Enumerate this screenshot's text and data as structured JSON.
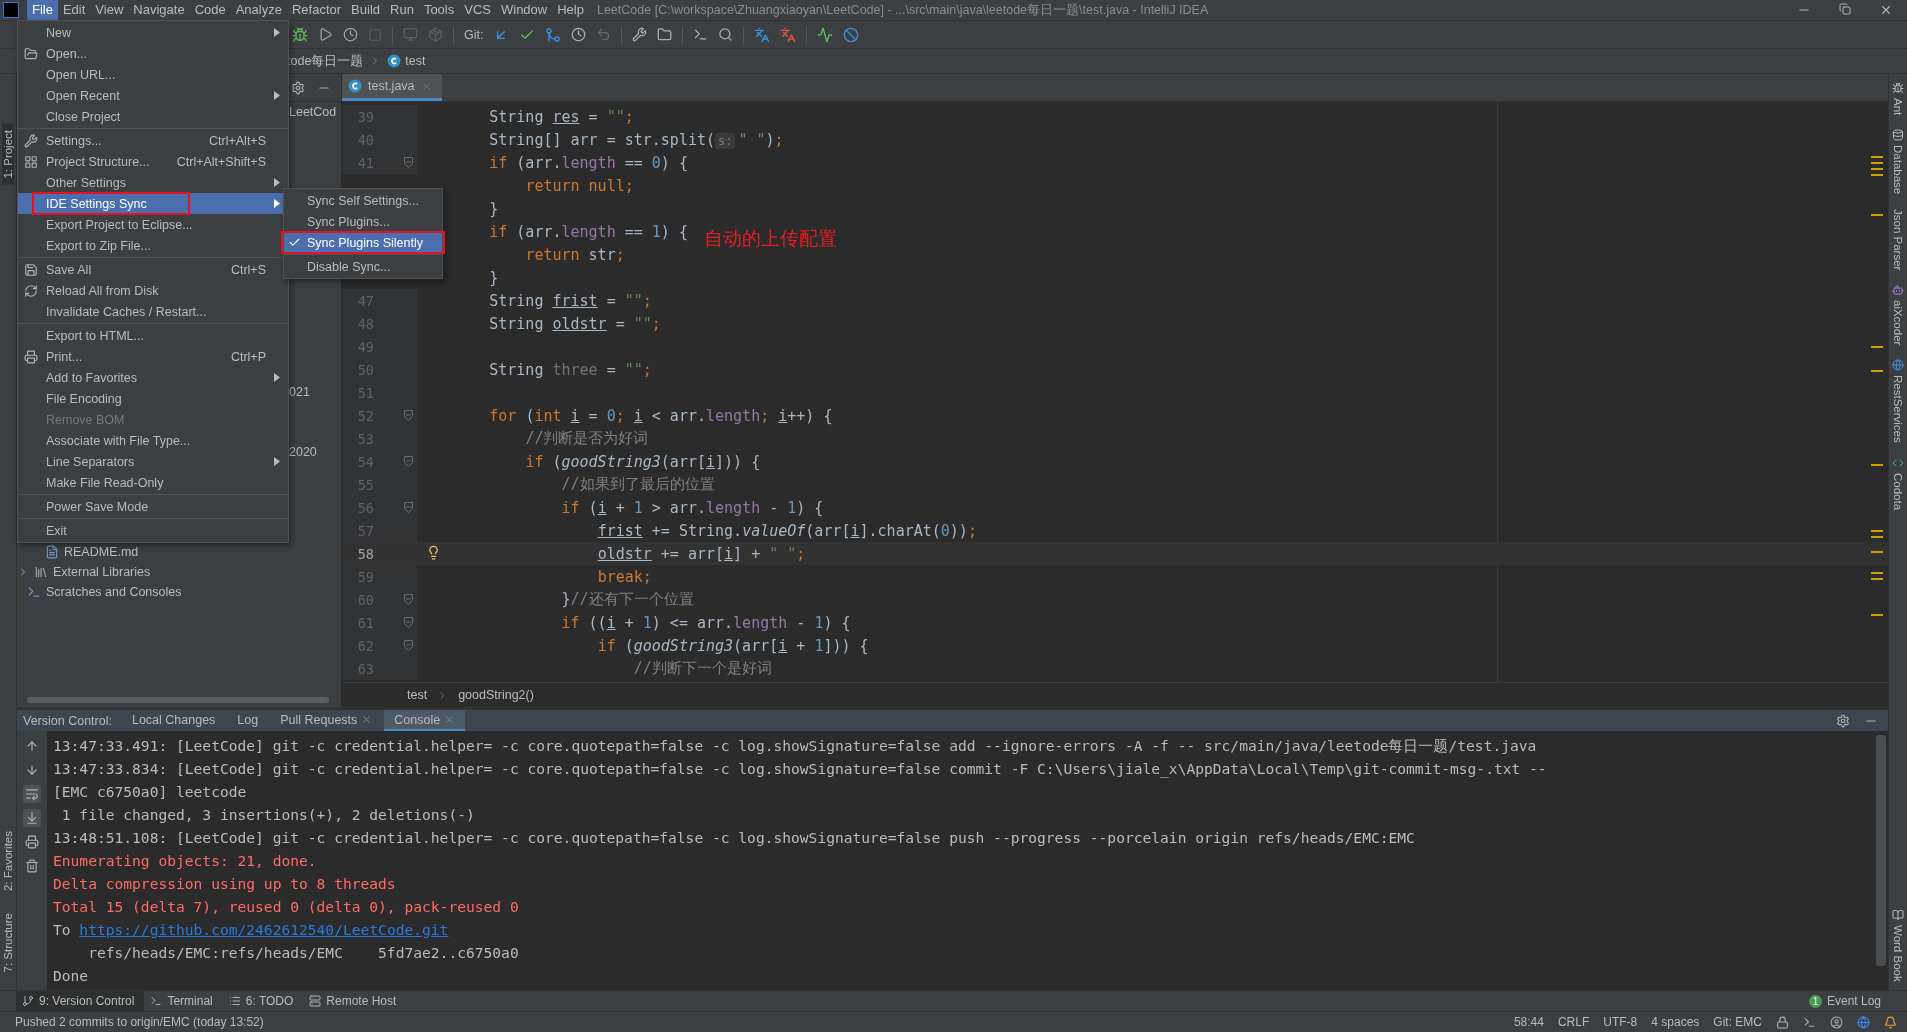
{
  "menubar": {
    "items": [
      {
        "label": "File",
        "selected": true
      },
      {
        "label": "Edit",
        "selected": false
      },
      {
        "label": "View",
        "selected": false
      },
      {
        "label": "Navigate",
        "selected": false
      },
      {
        "label": "Code",
        "selected": false
      },
      {
        "label": "Analyze",
        "selected": false
      },
      {
        "label": "Refactor",
        "selected": false
      },
      {
        "label": "Build",
        "selected": false
      },
      {
        "label": "Run",
        "selected": false
      },
      {
        "label": "Tools",
        "selected": false
      },
      {
        "label": "VCS",
        "selected": false
      },
      {
        "label": "Window",
        "selected": false
      },
      {
        "label": "Help",
        "selected": false
      }
    ],
    "title": "LeetCode [C:\\workspace\\Zhuangxiaoyan\\LeetCode] - ...\\src\\main\\java\\leetode每日一题\\test.java - IntelliJ IDEA"
  },
  "toolbar": {
    "git_label": "Git:"
  },
  "navbar": {
    "crumbs": [
      {
        "label": "tode每日一题"
      },
      {
        "label": "test"
      }
    ]
  },
  "left_strip": {
    "labels": [
      {
        "label": "1: Project",
        "selected": true
      },
      {
        "label": "2: Favorites",
        "selected": false
      },
      {
        "label": "7: Structure",
        "selected": false
      }
    ]
  },
  "project_panel": {
    "rows": [
      {
        "label": "LeetCod",
        "kind": "fragment"
      },
      {
        "label": "021",
        "kind": "fragment"
      },
      {
        "label": "2020",
        "kind": "fragment"
      },
      {
        "label": "README.md",
        "kind": "file"
      },
      {
        "label": "External Libraries",
        "kind": "library"
      },
      {
        "label": "Scratches and Consoles",
        "kind": "scratch"
      }
    ]
  },
  "editor": {
    "tab": {
      "label": "test.java",
      "selected": true
    },
    "lines": [
      {
        "number": "39",
        "current": false,
        "fold": false,
        "segs": [
          {
            "text": "        String ",
            "kind": "plain"
          },
          {
            "text": "res",
            "kind": "var"
          },
          {
            "text": " = ",
            "kind": "plain"
          },
          {
            "text": "\"\"",
            "kind": "string"
          },
          {
            "text": ";",
            "kind": "keyword"
          }
        ]
      },
      {
        "number": "40",
        "current": false,
        "fold": false,
        "segs": [
          {
            "text": "        String[] arr = str.split(",
            "kind": "plain"
          },
          {
            "text": "s:",
            "kind": "hint"
          },
          {
            "text": "\" \"",
            "kind": "string"
          },
          {
            "text": ")",
            "kind": "plain"
          },
          {
            "text": ";",
            "kind": "keyword"
          }
        ]
      },
      {
        "number": "41",
        "current": false,
        "fold": true,
        "segs": [
          {
            "text": "        if ",
            "kind": "keyword"
          },
          {
            "text": "(arr.",
            "kind": "plain"
          },
          {
            "text": "length",
            "kind": "field"
          },
          {
            "text": " == ",
            "kind": "plain"
          },
          {
            "text": "0",
            "kind": "number"
          },
          {
            "text": ") {",
            "kind": "plain"
          }
        ]
      },
      {
        "fold": false,
        "segs": [
          {
            "text": "            return null;",
            "kind": "keyword"
          }
        ]
      },
      {
        "fold": false,
        "segs": [
          {
            "text": "        }",
            "kind": "plain"
          }
        ]
      },
      {
        "fold": false,
        "segs": [
          {
            "text": "        if ",
            "kind": "keyword"
          },
          {
            "text": "(arr.",
            "kind": "plain"
          },
          {
            "text": "length",
            "kind": "field"
          },
          {
            "text": " == ",
            "kind": "plain"
          },
          {
            "text": "1",
            "kind": "number"
          },
          {
            "text": ") {",
            "kind": "plain"
          }
        ]
      },
      {
        "fold": false,
        "segs": [
          {
            "text": "            return ",
            "kind": "keyword"
          },
          {
            "text": "str",
            "kind": "plain"
          },
          {
            "text": ";",
            "kind": "keyword"
          }
        ]
      },
      {
        "fold": false,
        "segs": [
          {
            "text": "        }",
            "kind": "plain"
          }
        ]
      },
      {
        "number": "47",
        "current": false,
        "fold": false,
        "segs": [
          {
            "text": "        String ",
            "kind": "plain"
          },
          {
            "text": "frist",
            "kind": "var"
          },
          {
            "text": " = ",
            "kind": "plain"
          },
          {
            "text": "\"\"",
            "kind": "string"
          },
          {
            "text": ";",
            "kind": "keyword"
          }
        ]
      },
      {
        "number": "48",
        "current": false,
        "fold": false,
        "segs": [
          {
            "text": "        String ",
            "kind": "plain"
          },
          {
            "text": "oldstr",
            "kind": "var"
          },
          {
            "text": " = ",
            "kind": "plain"
          },
          {
            "text": "\"\"",
            "kind": "string"
          },
          {
            "text": ";",
            "kind": "keyword"
          }
        ]
      },
      {
        "number": "49",
        "current": false,
        "fold": false
      },
      {
        "number": "50",
        "current": false,
        "fold": false,
        "segs": [
          {
            "text": "        String ",
            "kind": "plain"
          },
          {
            "text": "three",
            "kind": "unused"
          },
          {
            "text": " = ",
            "kind": "plain"
          },
          {
            "text": "\"\"",
            "kind": "string"
          },
          {
            "text": ";",
            "kind": "keyword"
          }
        ]
      },
      {
        "number": "51",
        "current": false,
        "fold": false
      },
      {
        "number": "52",
        "current": false,
        "fold": true,
        "segs": [
          {
            "text": "        for ",
            "kind": "keyword"
          },
          {
            "text": "(",
            "kind": "plain"
          },
          {
            "text": "int ",
            "kind": "keyword"
          },
          {
            "text": "i",
            "kind": "var"
          },
          {
            "text": " = ",
            "kind": "plain"
          },
          {
            "text": "0",
            "kind": "number"
          },
          {
            "text": "; ",
            "kind": "keyword"
          },
          {
            "text": "i",
            "kind": "var"
          },
          {
            "text": " < arr.",
            "kind": "plain"
          },
          {
            "text": "length",
            "kind": "field"
          },
          {
            "text": "; ",
            "kind": "keyword"
          },
          {
            "text": "i",
            "kind": "var"
          },
          {
            "text": "++) {",
            "kind": "plain"
          }
        ]
      },
      {
        "number": "53",
        "current": false,
        "fold": false,
        "segs": [
          {
            "text": "            //判断是否为好词",
            "kind": "comment"
          }
        ]
      },
      {
        "number": "54",
        "current": false,
        "fold": true,
        "segs": [
          {
            "text": "            if ",
            "kind": "keyword"
          },
          {
            "text": "(",
            "kind": "plain"
          },
          {
            "text": "goodString3",
            "kind": "method"
          },
          {
            "text": "(arr[",
            "kind": "plain"
          },
          {
            "text": "i",
            "kind": "var"
          },
          {
            "text": "])) {",
            "kind": "plain"
          }
        ]
      },
      {
        "number": "55",
        "current": false,
        "fold": false,
        "segs": [
          {
            "text": "                //如果到了最后的位置",
            "kind": "comment"
          }
        ]
      },
      {
        "number": "56",
        "current": false,
        "fold": true,
        "segs": [
          {
            "text": "                if ",
            "kind": "keyword"
          },
          {
            "text": "(",
            "kind": "plain"
          },
          {
            "text": "i",
            "kind": "var"
          },
          {
            "text": " + ",
            "kind": "plain"
          },
          {
            "text": "1",
            "kind": "number"
          },
          {
            "text": " > arr.",
            "kind": "plain"
          },
          {
            "text": "length",
            "kind": "field"
          },
          {
            "text": " - ",
            "kind": "plain"
          },
          {
            "text": "1",
            "kind": "number"
          },
          {
            "text": ") {",
            "kind": "plain"
          }
        ]
      },
      {
        "number": "57",
        "current": false,
        "fold": false,
        "segs": [
          {
            "text": "                    frist",
            "kind": "var"
          },
          {
            "text": " += String.",
            "kind": "plain"
          },
          {
            "text": "valueOf",
            "kind": "method"
          },
          {
            "text": "(arr[",
            "kind": "plain"
          },
          {
            "text": "i",
            "kind": "var"
          },
          {
            "text": "].charAt(",
            "kind": "plain"
          },
          {
            "text": "0",
            "kind": "number"
          },
          {
            "text": "))",
            "kind": "plain"
          },
          {
            "text": ";",
            "kind": "keyword"
          }
        ]
      },
      {
        "number": "58",
        "current": true,
        "fold": false,
        "bulb": true,
        "segs": [
          {
            "text": "                    oldstr",
            "kind": "var"
          },
          {
            "text": " += arr[",
            "kind": "plain"
          },
          {
            "text": "i",
            "kind": "var"
          },
          {
            "text": "] + ",
            "kind": "plain"
          },
          {
            "text": "\" \"",
            "kind": "string"
          },
          {
            "text": ";",
            "kind": "keyword"
          }
        ]
      },
      {
        "number": "59",
        "current": false,
        "fold": false,
        "segs": [
          {
            "text": "                    break;",
            "kind": "keyword"
          }
        ]
      },
      {
        "number": "60",
        "current": false,
        "fold": true,
        "segs": [
          {
            "text": "                }",
            "kind": "plain"
          },
          {
            "text": "//还有下一个位置",
            "kind": "comment"
          }
        ]
      },
      {
        "number": "61",
        "current": false,
        "fold": true,
        "segs": [
          {
            "text": "                if ",
            "kind": "keyword"
          },
          {
            "text": "((",
            "kind": "plain"
          },
          {
            "text": "i",
            "kind": "var"
          },
          {
            "text": " + ",
            "kind": "plain"
          },
          {
            "text": "1",
            "kind": "number"
          },
          {
            "text": ") <= arr.",
            "kind": "plain"
          },
          {
            "text": "length",
            "kind": "field"
          },
          {
            "text": " - ",
            "kind": "plain"
          },
          {
            "text": "1",
            "kind": "number"
          },
          {
            "text": ") {",
            "kind": "plain"
          }
        ]
      },
      {
        "number": "62",
        "current": false,
        "fold": true,
        "segs": [
          {
            "text": "                    if",
            "kind": "keyword"
          },
          {
            "text": " (",
            "kind": "plain"
          },
          {
            "text": "goodString3",
            "kind": "method"
          },
          {
            "text": "(arr[",
            "kind": "plain"
          },
          {
            "text": "i",
            "kind": "var"
          },
          {
            "text": " + ",
            "kind": "plain"
          },
          {
            "text": "1",
            "kind": "number"
          },
          {
            "text": "])) {",
            "kind": "plain"
          }
        ]
      },
      {
        "number": "63",
        "current": false,
        "fold": false,
        "segs": [
          {
            "text": "                        //判断下一个是好词",
            "kind": "comment"
          }
        ]
      }
    ],
    "breadcrumb": [
      {
        "label": "test"
      },
      {
        "label": "goodString2()"
      }
    ]
  },
  "right_strip": {
    "labels": [
      {
        "label": "Ant"
      },
      {
        "label": "Database"
      },
      {
        "label": "Json Parser"
      },
      {
        "label": "aiXcoder"
      },
      {
        "label": "RestServices"
      },
      {
        "label": "Codota"
      },
      {
        "label": "Word Book"
      }
    ]
  },
  "file_menu": {
    "items": [
      {
        "label": "New",
        "arrow": true,
        "selected": false,
        "disabled": false,
        "boxed": false
      },
      {
        "label": "Open...",
        "arrow": false,
        "selected": false,
        "disabled": false,
        "boxed": false
      },
      {
        "label": "Open URL...",
        "arrow": false,
        "selected": false,
        "disabled": false,
        "boxed": false
      },
      {
        "label": "Open Recent",
        "arrow": true,
        "selected": false,
        "disabled": false,
        "boxed": false
      },
      {
        "label": "Close Project",
        "arrow": false,
        "selected": false,
        "disabled": false,
        "boxed": false
      },
      {
        "kind": "separator"
      },
      {
        "label": "Settings...",
        "shortcut": "Ctrl+Alt+S",
        "arrow": false,
        "selected": false,
        "disabled": false,
        "boxed": false
      },
      {
        "label": "Project Structure...",
        "shortcut": "Ctrl+Alt+Shift+S",
        "arrow": false,
        "selected": false,
        "disabled": false,
        "boxed": false
      },
      {
        "label": "Other Settings",
        "arrow": true,
        "selected": false,
        "disabled": false,
        "boxed": false
      },
      {
        "label": "IDE Settings Sync",
        "arrow": true,
        "selected": true,
        "disabled": false,
        "boxed": true
      },
      {
        "label": "Export Project to Eclipse...",
        "arrow": false,
        "selected": false,
        "disabled": false,
        "boxed": false
      },
      {
        "label": "Export to Zip File...",
        "arrow": false,
        "selected": false,
        "disabled": false,
        "boxed": false
      },
      {
        "kind": "separator"
      },
      {
        "label": "Save All",
        "shortcut": "Ctrl+S",
        "arrow": false,
        "selected": false,
        "disabled": false,
        "boxed": false
      },
      {
        "label": "Reload All from Disk",
        "arrow": false,
        "selected": false,
        "disabled": false,
        "boxed": false
      },
      {
        "label": "Invalidate Caches / Restart...",
        "arrow": false,
        "selected": false,
        "disabled": false,
        "boxed": false
      },
      {
        "kind": "separator"
      },
      {
        "label": "Export to HTML...",
        "arrow": false,
        "selected": false,
        "disabled": false,
        "boxed": false
      },
      {
        "label": "Print...",
        "shortcut": "Ctrl+P",
        "arrow": false,
        "selected": false,
        "disabled": false,
        "boxed": false
      },
      {
        "label": "Add to Favorites",
        "arrow": true,
        "selected": false,
        "disabled": false,
        "boxed": false
      },
      {
        "label": "File Encoding",
        "arrow": false,
        "selected": false,
        "disabled": false,
        "boxed": false
      },
      {
        "label": "Remove BOM",
        "arrow": false,
        "selected": false,
        "disabled": true,
        "boxed": false
      },
      {
        "label": "Associate with File Type...",
        "arrow": false,
        "selected": false,
        "disabled": false,
        "boxed": false
      },
      {
        "label": "Line Separators",
        "arrow": true,
        "selected": false,
        "disabled": false,
        "boxed": false
      },
      {
        "label": "Make File Read-Only",
        "arrow": false,
        "selected": false,
        "disabled": false,
        "boxed": false
      },
      {
        "kind": "separator"
      },
      {
        "label": "Power Save Mode",
        "arrow": false,
        "selected": false,
        "disabled": false,
        "boxed": false
      },
      {
        "kind": "separator"
      },
      {
        "label": "Exit",
        "arrow": false,
        "selected": false,
        "disabled": false,
        "boxed": false
      }
    ]
  },
  "submenu": {
    "items": [
      {
        "label": "Sync Self Settings...",
        "checked": false,
        "selected": false,
        "boxed": false
      },
      {
        "label": "Sync Plugins...",
        "checked": false,
        "selected": false,
        "boxed": false
      },
      {
        "label": "Sync Plugins Silently",
        "checked": true,
        "selected": true,
        "boxed": true
      },
      {
        "kind": "separator"
      },
      {
        "label": "Disable Sync...",
        "checked": false,
        "selected": false,
        "boxed": false
      }
    ]
  },
  "annotation": "自动的上传配置",
  "tool_window": {
    "title": "Version Control:",
    "tabs": [
      {
        "label": "Local Changes",
        "selected": false,
        "closable": false
      },
      {
        "label": "Log",
        "selected": false,
        "closable": false
      },
      {
        "label": "Pull Requests",
        "selected": false,
        "closable": true
      },
      {
        "label": "Console",
        "selected": true,
        "closable": true
      }
    ],
    "toggles": {
      "soft_wrap": true,
      "scroll_to_end": true
    },
    "lines": [
      {
        "kind": "normal",
        "text": "13:47:33.491: [LeetCode] git -c credential.helper= -c core.quotepath=false -c log.showSignature=false add --ignore-errors -A -f -- src/main/java/leetode每日一题/test.java"
      },
      {
        "kind": "normal",
        "text": "13:47:33.834: [LeetCode] git -c credential.helper= -c core.quotepath=false -c log.showSignature=false commit -F C:\\Users\\jiale_x\\AppData\\Local\\Temp\\git-commit-msg-.txt --"
      },
      {
        "kind": "normal",
        "text": "[EMC c6750a0] leetcode"
      },
      {
        "kind": "normal",
        "text": " 1 file changed, 3 insertions(+), 2 deletions(-)"
      },
      {
        "kind": "normal",
        "text": "13:48:51.108: [LeetCode] git -c credential.helper= -c core.quotepath=false -c log.showSignature=false push --progress --porcelain origin refs/heads/EMC:EMC"
      },
      {
        "kind": "error",
        "text": "Enumerating objects: 21, done."
      },
      {
        "kind": "error",
        "text": "Delta compression using up to 8 threads"
      },
      {
        "kind": "error",
        "text": "Total 15 (delta 7), reused 0 (delta 0), pack-reused 0"
      },
      {
        "kind": "link",
        "text": "To ",
        "link": "https://github.com/2462612540/LeetCode.git"
      },
      {
        "kind": "normal",
        "text": "    refs/heads/EMC:refs/heads/EMC    5fd7ae2..c6750a0"
      },
      {
        "kind": "normal",
        "text": "Done"
      }
    ]
  },
  "tool_strip": {
    "tabs": [
      {
        "label": "9: Version Control",
        "selected": true
      },
      {
        "label": "Terminal",
        "selected": false
      },
      {
        "label": "6: TODO",
        "selected": false
      },
      {
        "label": "Remote Host",
        "selected": false
      }
    ],
    "event_log": {
      "badge": "1",
      "label": "Event Log"
    }
  },
  "status_bar": {
    "message": "Pushed 2 commits to origin/EMC (today 13:52)",
    "items": [
      "58:44",
      "CRLF",
      "UTF-8",
      "4 spaces",
      "Git: EMC"
    ]
  }
}
